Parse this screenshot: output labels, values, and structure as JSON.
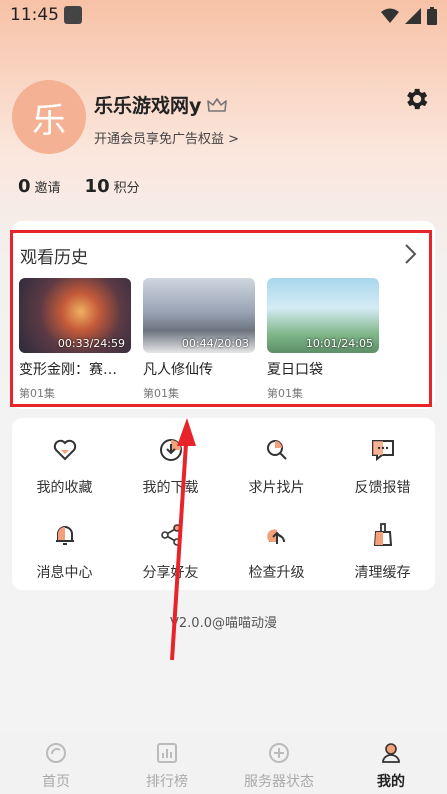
{
  "status_bar": {
    "time": "11:45"
  },
  "profile": {
    "avatar_char": "乐",
    "username": "乐乐游戏网y",
    "vip_promo": "开通会员享免广告权益 >"
  },
  "stats": [
    {
      "value": "0",
      "label": "邀请"
    },
    {
      "value": "10",
      "label": "积分"
    }
  ],
  "history": {
    "title": "观看历史",
    "items": [
      {
        "name": "变形金刚：赛…",
        "episode": "第01集",
        "progress": "00:33/24:59"
      },
      {
        "name": "凡人修仙传",
        "episode": "第01集",
        "progress": "00:44/20:03"
      },
      {
        "name": "夏日口袋",
        "episode": "第01集",
        "progress": "10:01/24:05"
      }
    ]
  },
  "menu": [
    {
      "label": "我的收藏",
      "icon": "heart-icon"
    },
    {
      "label": "我的下载",
      "icon": "download-icon"
    },
    {
      "label": "求片找片",
      "icon": "search-icon"
    },
    {
      "label": "反馈报错",
      "icon": "feedback-icon"
    },
    {
      "label": "消息中心",
      "icon": "bell-icon"
    },
    {
      "label": "分享好友",
      "icon": "share-icon"
    },
    {
      "label": "检查升级",
      "icon": "upgrade-icon"
    },
    {
      "label": "清理缓存",
      "icon": "broom-icon"
    }
  ],
  "version": "V2.0.0@喵喵动漫",
  "tabs": [
    {
      "label": "首页",
      "icon": "home-icon",
      "active": false
    },
    {
      "label": "排行榜",
      "icon": "chart-icon",
      "active": false
    },
    {
      "label": "服务器状态",
      "icon": "server-icon",
      "active": false
    },
    {
      "label": "我的",
      "icon": "profile-icon",
      "active": true
    }
  ],
  "colors": {
    "accent": "#f5b193",
    "highlight_border": "#e8242b",
    "arrow": "#e8242b"
  }
}
